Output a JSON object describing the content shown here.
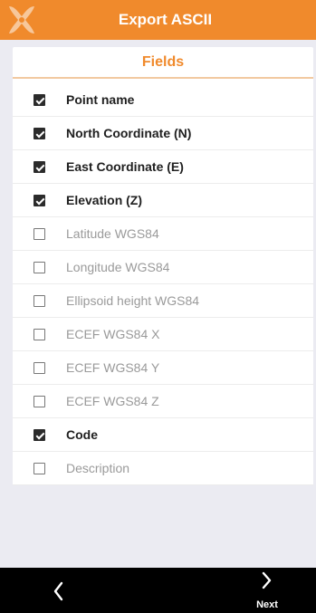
{
  "header": {
    "title": "Export ASCII",
    "logo_icon": "app-logo-icon"
  },
  "section": {
    "title": "Fields"
  },
  "fields": [
    {
      "label": "Point name",
      "checked": true
    },
    {
      "label": "North Coordinate (N)",
      "checked": true
    },
    {
      "label": "East Coordinate (E)",
      "checked": true
    },
    {
      "label": "Elevation (Z)",
      "checked": true
    },
    {
      "label": "Latitude WGS84",
      "checked": false
    },
    {
      "label": "Longitude WGS84",
      "checked": false
    },
    {
      "label": "Ellipsoid height WGS84",
      "checked": false
    },
    {
      "label": "ECEF WGS84 X",
      "checked": false
    },
    {
      "label": "ECEF WGS84 Y",
      "checked": false
    },
    {
      "label": "ECEF WGS84 Z",
      "checked": false
    },
    {
      "label": "Code",
      "checked": true
    },
    {
      "label": "Description",
      "checked": false
    }
  ],
  "footer": {
    "back_icon": "chevron-left-icon",
    "next_icon": "chevron-right-icon",
    "next_label": "Next"
  },
  "colors": {
    "accent": "#f08a2c",
    "background": "#ebebf2",
    "footer": "#000000"
  }
}
